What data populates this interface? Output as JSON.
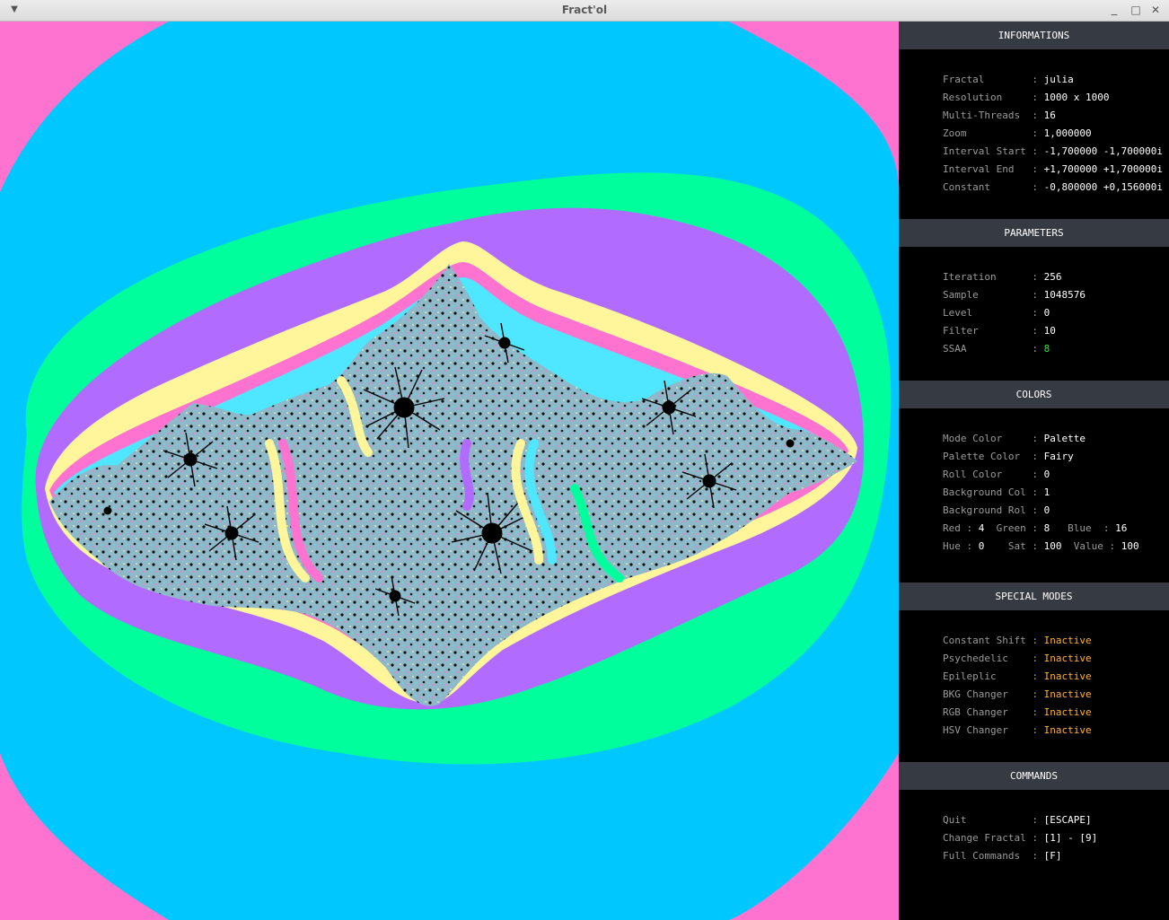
{
  "window": {
    "title": "Fract'ol",
    "menu_icon": "chevron-down-icon",
    "minimize": "_",
    "maximize": "□",
    "close": "✕"
  },
  "palette": {
    "pink": "#ff73d0",
    "cyan": "#00c8ff",
    "green": "#00ff9c",
    "purple": "#b26bff",
    "yellow": "#fff59a",
    "sky": "#52d8ff",
    "dark": "#0a0a0a"
  },
  "sections": {
    "informations": {
      "header": "INFORMATIONS",
      "rows": [
        {
          "label": "Fractal       ",
          "value": "julia"
        },
        {
          "label": "Resolution    ",
          "value": "1000 x 1000"
        },
        {
          "label": "Multi-Threads ",
          "value": "16"
        },
        {
          "label": "Zoom          ",
          "value": "1,000000"
        },
        {
          "label": "Interval Start",
          "value": "-1,700000 -1,700000i"
        },
        {
          "label": "Interval End  ",
          "value": "+1,700000 +1,700000i"
        },
        {
          "label": "Constant      ",
          "value": "-0,800000 +0,156000i"
        }
      ]
    },
    "parameters": {
      "header": "PARAMETERS",
      "rows": [
        {
          "label": "Iteration     ",
          "value": "256"
        },
        {
          "label": "Sample        ",
          "value": "1048576"
        },
        {
          "label": "Level         ",
          "value": "0"
        },
        {
          "label": "Filter        ",
          "value": "10"
        },
        {
          "label": "SSAA          ",
          "value": "8"
        }
      ]
    },
    "colors": {
      "header": "COLORS",
      "rows": [
        {
          "label": "Mode Color    ",
          "value": "Palette"
        },
        {
          "label": "Palette Color ",
          "value": "Fairy"
        },
        {
          "label": "Roll Color    ",
          "value": "0"
        },
        {
          "label": "Background Col",
          "value": "1"
        },
        {
          "label": "Background Rol",
          "value": "0"
        }
      ],
      "rgb": {
        "red_label": "Red",
        "red": "4",
        "green_label": "Green",
        "green": "8",
        "blue_label": "Blue",
        "blue": "16"
      },
      "hsv": {
        "hue_label": "Hue",
        "hue": "0",
        "sat_label": "Sat",
        "sat": "100",
        "value_label": "Value",
        "value": "100"
      }
    },
    "special_modes": {
      "header": "SPECIAL MODES",
      "rows": [
        {
          "label": "Constant Shift",
          "value": "Inactive"
        },
        {
          "label": "Psychedelic   ",
          "value": "Inactive"
        },
        {
          "label": "Epileplic     ",
          "value": "Inactive"
        },
        {
          "label": "BKG Changer   ",
          "value": "Inactive"
        },
        {
          "label": "RGB Changer   ",
          "value": "Inactive"
        },
        {
          "label": "HSV Changer   ",
          "value": "Inactive"
        }
      ]
    },
    "commands": {
      "header": "COMMANDS",
      "rows": [
        {
          "label": "Quit          ",
          "value": "[ESCAPE]"
        },
        {
          "label": "Change Fractal",
          "value": "[1] - [9]"
        },
        {
          "label": "Full Commands ",
          "value": "[F]"
        }
      ]
    }
  }
}
